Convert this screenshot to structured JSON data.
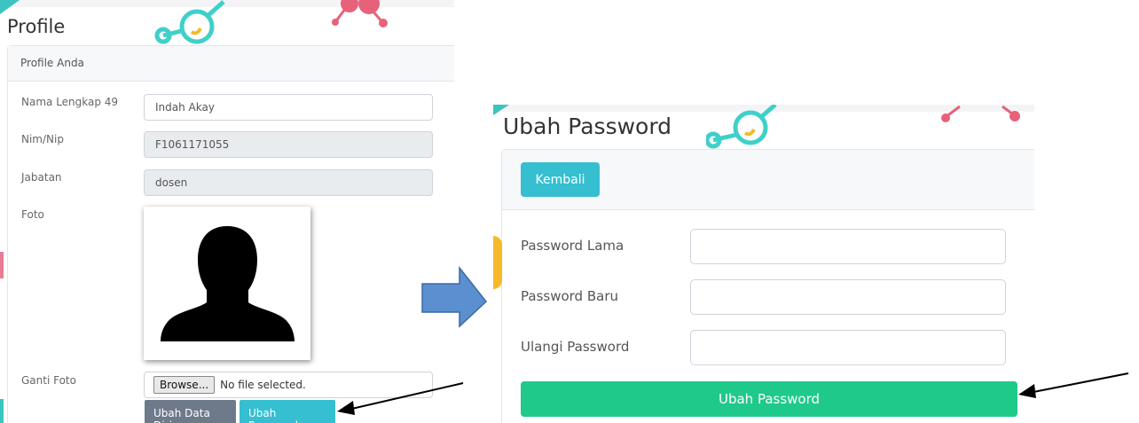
{
  "profile": {
    "title": "Profile",
    "card_header": "Profile Anda",
    "fields": [
      {
        "label": "Nama Lengkap 49",
        "value": "Indah Akay",
        "readonly": false
      },
      {
        "label": "Nim/Nip",
        "value": "F1061171055",
        "readonly": true
      },
      {
        "label": "Jabatan",
        "value": "dosen",
        "readonly": true
      }
    ],
    "photo_label": "Foto",
    "change_photo_label": "Ganti Foto",
    "browse_label": "Browse...",
    "no_file_text": "No file selected.",
    "btn_edit_data": "Ubah Data Diri",
    "btn_change_password": "Ubah Password"
  },
  "change_password": {
    "title": "Ubah Password",
    "back_button": "Kembali",
    "fields": [
      {
        "label": "Password Lama",
        "value": ""
      },
      {
        "label": "Password Baru",
        "value": ""
      },
      {
        "label": "Ulangi Password",
        "value": ""
      }
    ],
    "submit_button": "Ubah Password"
  },
  "colors": {
    "teal": "#35bfd0",
    "gray": "#6e7a8a",
    "green": "#1fc98a",
    "arrow_blue": "#5b8fcf",
    "molecule_teal": "#3fd0c9",
    "molecule_pink": "#e8617a",
    "molecule_yellow": "#f5b929"
  },
  "icons": {
    "avatar": "person-silhouette-icon",
    "flow_arrow": "right-arrow-icon",
    "pointer_arrow": "pointer-arrow-icon"
  }
}
